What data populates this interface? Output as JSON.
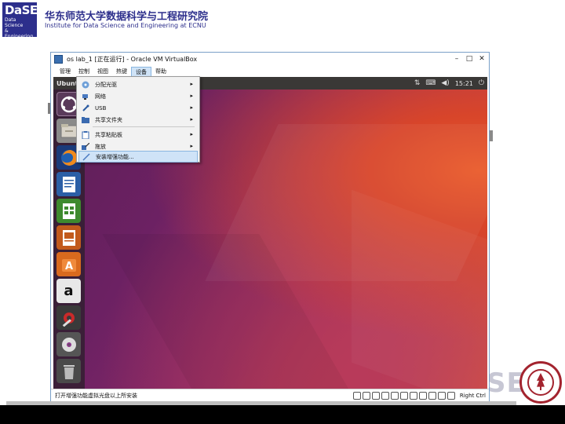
{
  "slide": {
    "logo_big": "DaSE",
    "logo_line1": "Data Science",
    "logo_line2": "& Engineering",
    "inst_cn": "华东师范大学数据科学与工程研究院",
    "inst_en": "Institute for Data Science and Engineering at ECNU",
    "watermark": "SE"
  },
  "window": {
    "title": "os lab_1 [正在运行] - Oracle VM VirtualBox",
    "minimize": "–",
    "maximize": "□",
    "close": "✕"
  },
  "menubar": {
    "items": [
      {
        "label": "管理"
      },
      {
        "label": "控制"
      },
      {
        "label": "视图"
      },
      {
        "label": "热键"
      },
      {
        "label": "设备"
      },
      {
        "label": "帮助"
      }
    ]
  },
  "guest": {
    "panel_title": "Ubuntu 桌面",
    "clock": "15:21"
  },
  "launcher": {
    "items": [
      {
        "name": "dash-icon"
      },
      {
        "name": "files-icon"
      },
      {
        "name": "firefox-icon"
      },
      {
        "name": "writer-icon"
      },
      {
        "name": "calc-icon"
      },
      {
        "name": "impress-icon"
      },
      {
        "name": "software-center-icon"
      },
      {
        "name": "amazon-icon",
        "glyph": "a"
      },
      {
        "name": "system-settings-icon"
      },
      {
        "name": "dvd-icon"
      },
      {
        "name": "trash-icon"
      }
    ]
  },
  "devices_menu": {
    "items": [
      {
        "label": "分配光驱",
        "has_submenu": true
      },
      {
        "label": "网络",
        "has_submenu": true
      },
      {
        "label": "USB",
        "has_submenu": true
      },
      {
        "label": "共享文件夹",
        "has_submenu": true
      },
      {
        "label": "共享粘贴板",
        "has_submenu": true
      },
      {
        "label": "拖放",
        "has_submenu": true
      },
      {
        "label": "安装增强功能...",
        "has_submenu": false,
        "highlighted": true
      }
    ],
    "submenu_arrow": "▸"
  },
  "statusbar": {
    "text": "打开增强功能虚拟光盘以上所安装",
    "host_key": "Right Ctrl"
  },
  "colors": {
    "accent_blue": "#2d2f8c",
    "menu_highlight": "#cfe3f7",
    "ubuntu_orange": "#e95420"
  }
}
